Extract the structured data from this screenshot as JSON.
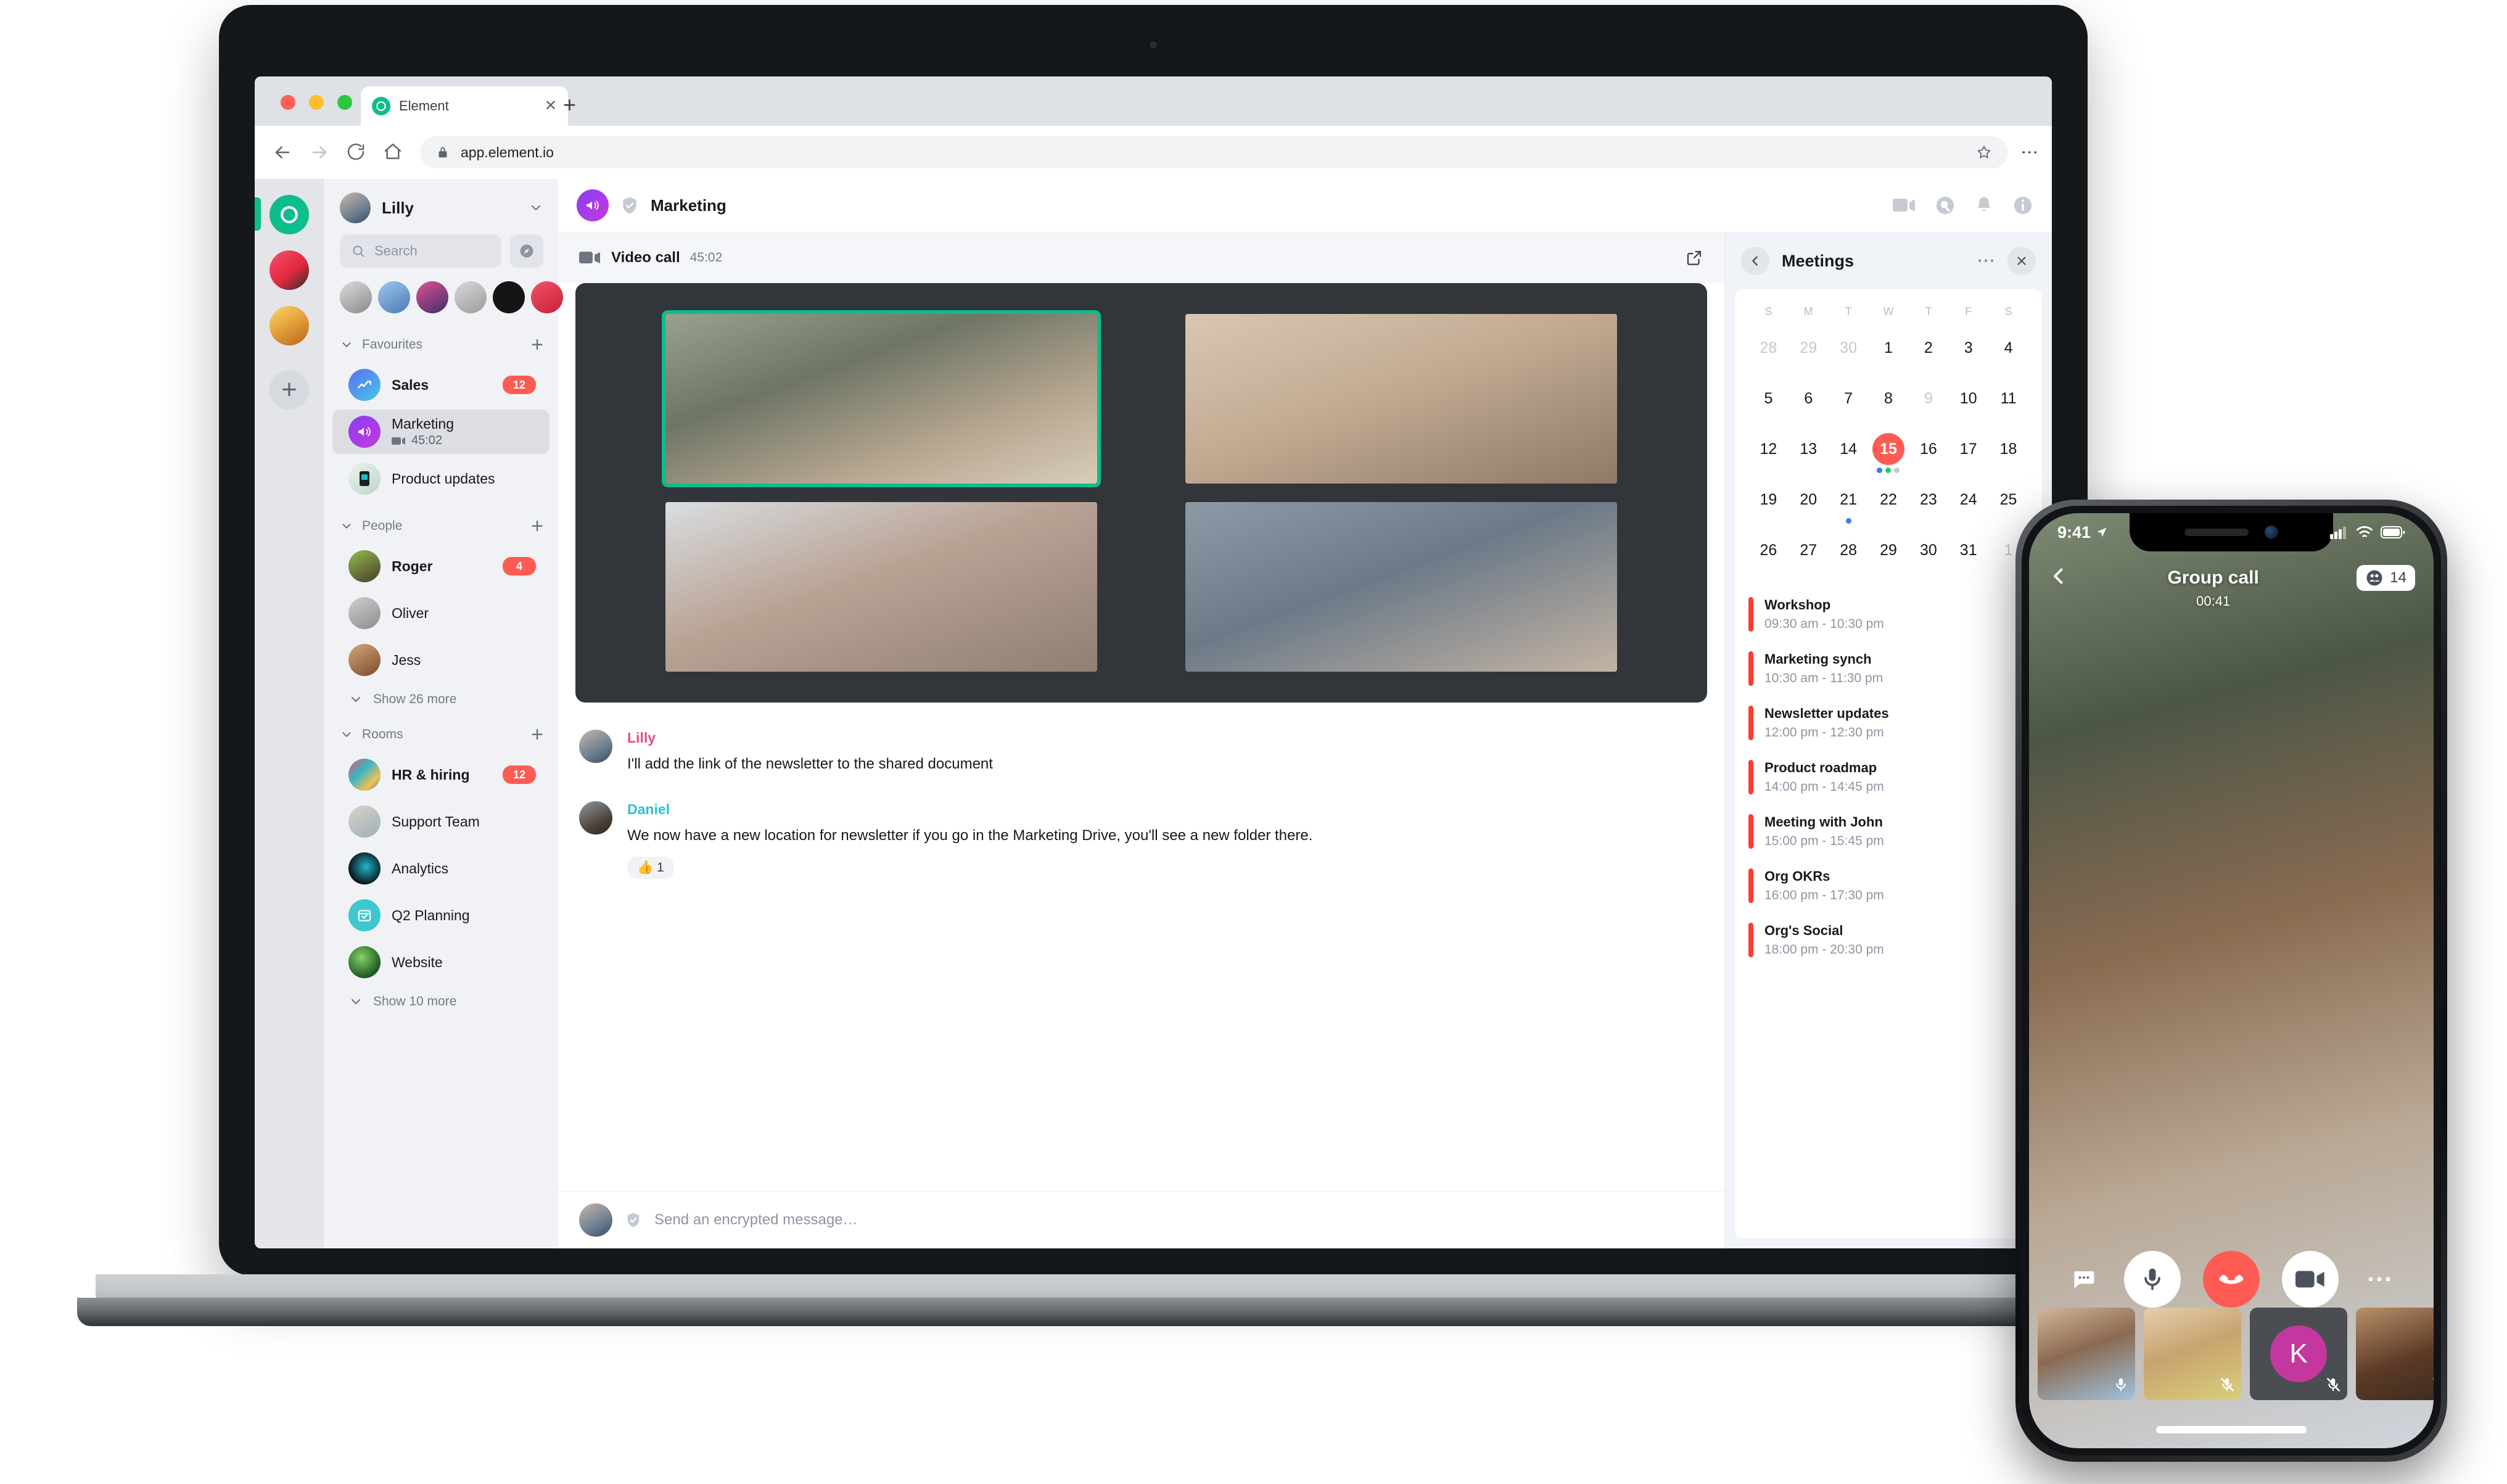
{
  "browser": {
    "tab_title": "Element",
    "tab_close": "✕",
    "new_tab": "+",
    "url": "app.element.io",
    "icons": {
      "back": "back-arrow-icon",
      "forward": "forward-arrow-icon",
      "reload": "reload-icon",
      "home": "home-icon",
      "lock": "lock-icon",
      "star": "star-icon",
      "menu": "kebab-menu-icon"
    }
  },
  "app": {
    "user": {
      "name": "Lilly"
    },
    "search": {
      "placeholder": "Search"
    },
    "sections": [
      {
        "title": "Favourites",
        "add_label": "+"
      },
      {
        "title": "People",
        "add_label": "+"
      },
      {
        "title": "Rooms",
        "add_label": "+"
      }
    ],
    "favourites": [
      {
        "name": "Sales",
        "badge": "12",
        "bold": true,
        "sub": ""
      },
      {
        "name": "Marketing",
        "badge": "",
        "bold": false,
        "sub": "45:02",
        "active": true
      },
      {
        "name": "Product updates",
        "badge": "",
        "bold": false,
        "sub": ""
      }
    ],
    "people": [
      {
        "name": "Roger",
        "badge": "4",
        "bold": true
      },
      {
        "name": "Oliver",
        "badge": "",
        "bold": false
      },
      {
        "name": "Jess",
        "badge": "",
        "bold": false
      }
    ],
    "people_more": "Show 26 more",
    "rooms": [
      {
        "name": "HR & hiring",
        "badge": "12",
        "bold": true
      },
      {
        "name": "Support Team",
        "badge": "",
        "bold": false
      },
      {
        "name": "Analytics",
        "badge": "",
        "bold": false
      },
      {
        "name": "Q2 Planning",
        "badge": "",
        "bold": false
      },
      {
        "name": "Website",
        "badge": "",
        "bold": false
      }
    ],
    "rooms_more": "Show 10 more",
    "room_header": {
      "title": "Marketing",
      "icons": [
        "video-camera-icon",
        "search-icon",
        "notifications-bell-icon",
        "room-info-icon"
      ]
    },
    "call": {
      "label": "Video call",
      "duration": "45:02",
      "popout_icon": "pop-out-icon",
      "participants": 4,
      "speaking_index": 0
    },
    "messages": [
      {
        "sender": "Lilly",
        "color": "#e64f7a",
        "text": "I'll add the link of the newsletter to the shared document",
        "reaction": ""
      },
      {
        "sender": "Daniel",
        "color": "#2dc2d6",
        "text": "We now have a new location for newsletter if you go in the Marketing Drive, you'll see a new folder there.",
        "reaction": "👍 1"
      }
    ],
    "composer": {
      "placeholder": "Send an encrypted message…"
    }
  },
  "meetings": {
    "title": "Meetings",
    "back_icon": "chevron-left-icon",
    "more_icon": "more-options-icon",
    "close_icon": "close-icon",
    "calendar": {
      "dow": [
        "S",
        "M",
        "T",
        "W",
        "T",
        "F",
        "S"
      ],
      "weeks": [
        [
          {
            "n": "28",
            "mute": true
          },
          {
            "n": "29",
            "mute": true
          },
          {
            "n": "30",
            "mute": true
          },
          {
            "n": "1"
          },
          {
            "n": "2"
          },
          {
            "n": "3"
          },
          {
            "n": "4"
          }
        ],
        [
          {
            "n": "5"
          },
          {
            "n": "6"
          },
          {
            "n": "7"
          },
          {
            "n": "8"
          },
          {
            "n": "9",
            "mute": true
          },
          {
            "n": "10"
          },
          {
            "n": "11"
          }
        ],
        [
          {
            "n": "12"
          },
          {
            "n": "13"
          },
          {
            "n": "14"
          },
          {
            "n": "15",
            "today": true,
            "dots": [
              "#3a7bfd",
              "#1ec87d",
              "#c3c8d0"
            ]
          },
          {
            "n": "16"
          },
          {
            "n": "17"
          },
          {
            "n": "18"
          }
        ],
        [
          {
            "n": "19"
          },
          {
            "n": "20"
          },
          {
            "n": "21",
            "dots": [
              "#3a7bfd"
            ]
          },
          {
            "n": "22"
          },
          {
            "n": "23"
          },
          {
            "n": "24"
          },
          {
            "n": "25"
          }
        ],
        [
          {
            "n": "26"
          },
          {
            "n": "27"
          },
          {
            "n": "28"
          },
          {
            "n": "29"
          },
          {
            "n": "30"
          },
          {
            "n": "31"
          },
          {
            "n": "1",
            "mute": true
          }
        ]
      ]
    },
    "events": [
      {
        "title": "Workshop",
        "time": "09:30 am - 10:30 pm"
      },
      {
        "title": "Marketing synch",
        "time": "10:30 am - 11:30 pm"
      },
      {
        "title": "Newsletter updates",
        "time": "12:00 pm - 12:30 pm"
      },
      {
        "title": "Product roadmap",
        "time": "14:00 pm - 14:45 pm"
      },
      {
        "title": "Meeting with John",
        "time": "15:00 pm - 15:45 pm"
      },
      {
        "title": "Org OKRs",
        "time": "16:00 pm - 17:30 pm"
      },
      {
        "title": "Org's Social",
        "time": "18:00 pm - 20:30 pm"
      }
    ]
  },
  "phone": {
    "status_time": "9:41",
    "status_icons": [
      "cellular-signal-icon",
      "wifi-icon",
      "battery-icon"
    ],
    "back_icon": "chevron-left-icon",
    "call_title": "Group call",
    "call_timer": "00:41",
    "participant_count": "14",
    "participants_icon": "people-group-icon",
    "controls": [
      {
        "name": "chat-icon",
        "style": "ghost"
      },
      {
        "name": "microphone-icon",
        "style": "white"
      },
      {
        "name": "hang-up-icon",
        "style": "hangup"
      },
      {
        "name": "video-camera-icon",
        "style": "white"
      },
      {
        "name": "more-options-icon",
        "style": "ghost"
      }
    ],
    "thumbnails": [
      {
        "kind": "video",
        "muted": false
      },
      {
        "kind": "video",
        "muted": true
      },
      {
        "kind": "initial",
        "initial": "K",
        "muted": true
      },
      {
        "kind": "video",
        "muted": true
      }
    ]
  },
  "colors": {
    "brand_green": "#0dbd8b",
    "badge_red": "#ff5b55",
    "today_red": "#ff5b55",
    "event_bar_red": "#ff3b30",
    "speaking_border": "#0dbd8b"
  }
}
